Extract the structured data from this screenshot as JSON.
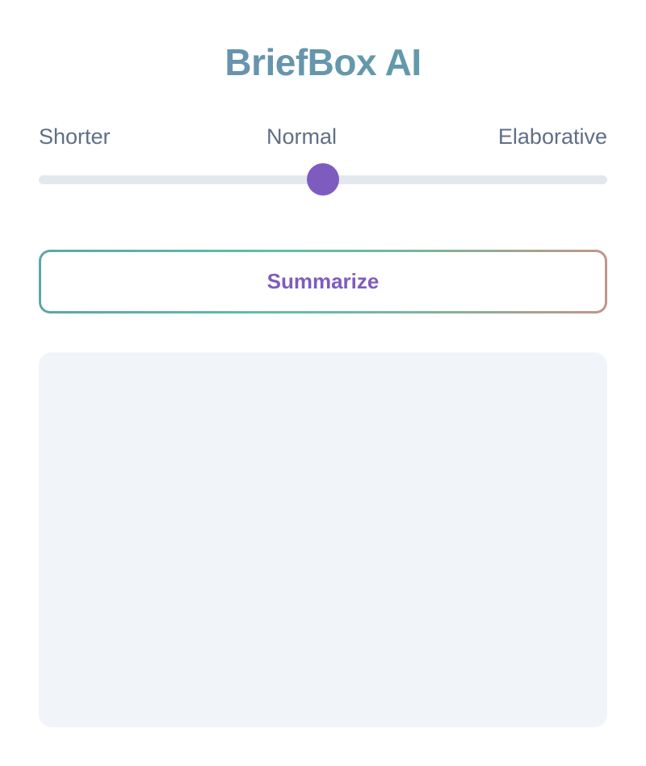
{
  "app": {
    "title": "BriefBox AI"
  },
  "length_slider": {
    "labels": [
      "Shorter",
      "Normal",
      "Elaborative"
    ],
    "value_fraction": 0.5,
    "track_color": "#e3e8ef",
    "thumb_color": "#7e5cbf"
  },
  "summarize_button": {
    "label": "Summarize",
    "text_color": "#7e5cbf",
    "border_gradient": [
      "#5ea5ad",
      "#5fc1a2",
      "#c2958a"
    ]
  },
  "summary_output": {
    "text": "",
    "background": "#f1f4f9"
  },
  "colors": {
    "title_gradient": [
      "#6f88b8",
      "#5ba5a2"
    ],
    "label_text": "#5f6f86"
  }
}
